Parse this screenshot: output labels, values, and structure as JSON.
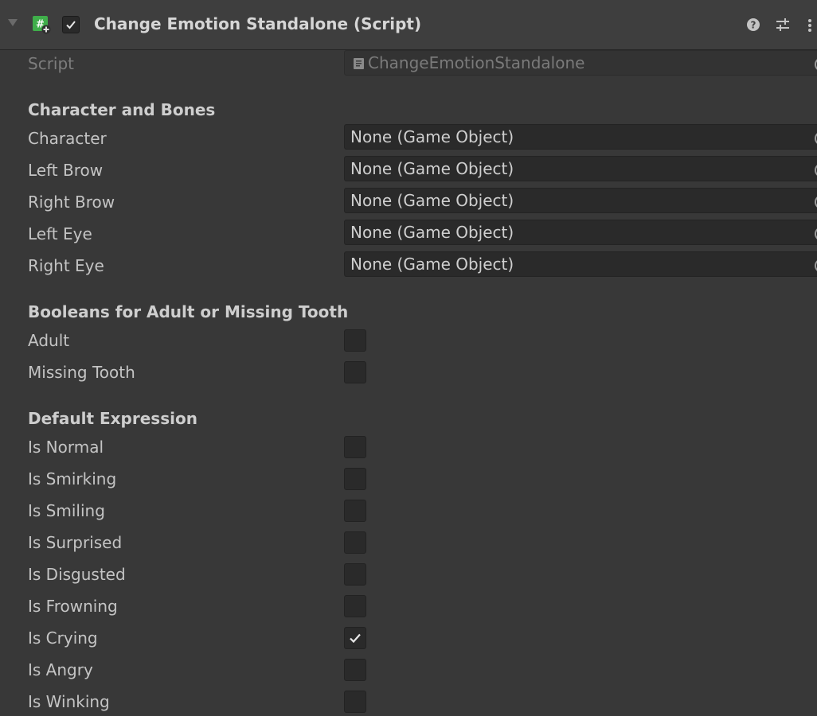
{
  "header": {
    "title": "Change Emotion Standalone (Script)",
    "enabled": true
  },
  "script_field": {
    "label": "Script",
    "value": "ChangeEmotionStandalone"
  },
  "sections": {
    "bones": {
      "title": "Character and Bones",
      "fields": [
        {
          "label": "Character",
          "value": "None (Game Object)"
        },
        {
          "label": "Left Brow",
          "value": "None (Game Object)"
        },
        {
          "label": "Right Brow",
          "value": "None (Game Object)"
        },
        {
          "label": "Left Eye",
          "value": "None (Game Object)"
        },
        {
          "label": "Right Eye",
          "value": "None (Game Object)"
        }
      ]
    },
    "booleans": {
      "title": "Booleans for Adult or Missing Tooth",
      "fields": [
        {
          "label": "Adult",
          "checked": false
        },
        {
          "label": "Missing Tooth",
          "checked": false
        }
      ]
    },
    "expression": {
      "title": "Default Expression",
      "fields": [
        {
          "label": "Is Normal",
          "checked": false
        },
        {
          "label": "Is Smirking",
          "checked": false
        },
        {
          "label": "Is Smiling",
          "checked": false
        },
        {
          "label": "Is Surprised",
          "checked": false
        },
        {
          "label": "Is Disgusted",
          "checked": false
        },
        {
          "label": "Is Frowning",
          "checked": false
        },
        {
          "label": "Is Crying",
          "checked": true
        },
        {
          "label": "Is Angry",
          "checked": false
        },
        {
          "label": "Is Winking",
          "checked": false
        }
      ]
    }
  },
  "colors": {
    "background": "#383838",
    "field": "#2a2a2a",
    "script_icon": "#3fae4a"
  }
}
